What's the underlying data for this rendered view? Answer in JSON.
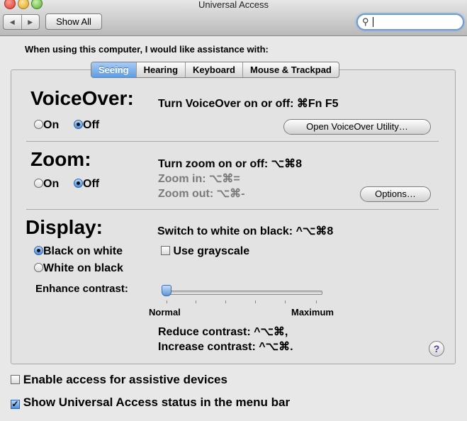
{
  "window": {
    "title": "Universal Access"
  },
  "toolbar": {
    "back_arrow": "◀",
    "forward_arrow": "▶",
    "show_all": "Show All",
    "search_value": ""
  },
  "intro": "When using this computer, I would like assistance with:",
  "tabs": [
    "Seeing",
    "Hearing",
    "Keyboard",
    "Mouse & Trackpad"
  ],
  "active_tab": "Seeing",
  "voiceover": {
    "heading": "VoiceOver:",
    "shortcut": "Turn VoiceOver on or off: ⌘Fn F5",
    "on": "On",
    "off": "Off",
    "selected": "Off",
    "utility_button": "Open VoiceOver Utility…"
  },
  "zoom": {
    "heading": "Zoom:",
    "shortcut": "Turn zoom on or off: ⌥⌘8",
    "zoom_in": "Zoom in: ⌥⌘=",
    "zoom_out": "Zoom out: ⌥⌘-",
    "on": "On",
    "off": "Off",
    "selected": "Off",
    "options_button": "Options…"
  },
  "display": {
    "heading": "Display:",
    "shortcut": "Switch to white on black: ^⌥⌘8",
    "black_on_white": "Black on white",
    "white_on_black": "White on black",
    "selected": "Black on white",
    "grayscale": "Use grayscale",
    "grayscale_checked": false,
    "enhance_contrast": "Enhance contrast:",
    "slider_min": "Normal",
    "slider_max": "Maximum",
    "slider_value": 0,
    "reduce": "Reduce contrast: ^⌥⌘,",
    "increase": "Increase contrast: ^⌥⌘."
  },
  "help": "?",
  "bottom": {
    "assistive": "Enable access for assistive devices",
    "assistive_checked": false,
    "status": "Show Universal Access status in the menu bar",
    "status_checked": true
  }
}
